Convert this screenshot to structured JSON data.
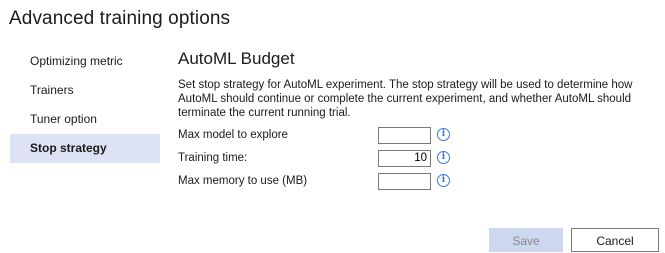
{
  "dialog": {
    "title": "Advanced training options"
  },
  "nav": {
    "items": [
      {
        "label": "Optimizing metric"
      },
      {
        "label": "Trainers"
      },
      {
        "label": "Tuner option"
      },
      {
        "label": "Stop strategy"
      }
    ],
    "selected": "Stop strategy"
  },
  "main": {
    "section_title": "AutoML Budget",
    "description": "Set stop strategy for AutoML experiment. The stop strategy will be used to determine how AutoML should continue or complete the current experiment, and whether AutoML should terminate the current  running trial.",
    "fields": [
      {
        "label": "Max model to explore",
        "value": ""
      },
      {
        "label": "Training time:",
        "value": "10"
      },
      {
        "label": "Max memory to use (MB)",
        "value": ""
      }
    ],
    "info_icon": "info-icon"
  },
  "buttons": {
    "save": "Save",
    "cancel": "Cancel"
  },
  "colors": {
    "selected_nav_bg": "#dde3f4",
    "info_icon": "#3c78d8",
    "disabled_button_bg": "#cdd7ee"
  }
}
